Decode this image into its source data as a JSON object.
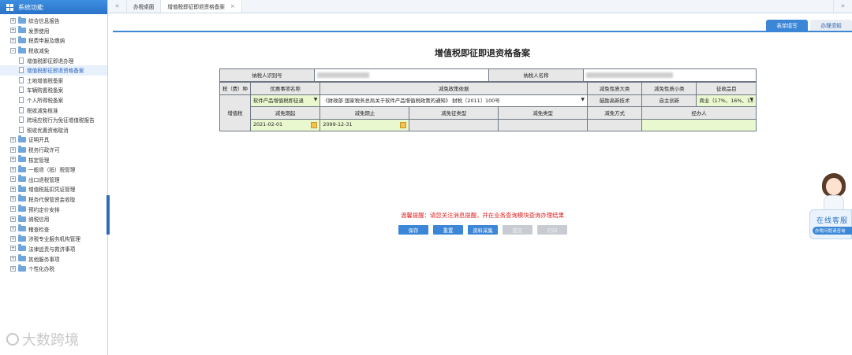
{
  "sidebar": {
    "title": "系统功能",
    "items": [
      {
        "label": "综合信息报告",
        "level": "top",
        "expanded": false
      },
      {
        "label": "发票使用",
        "level": "top",
        "expanded": false
      },
      {
        "label": "税费申报及缴纳",
        "level": "top",
        "expanded": false
      },
      {
        "label": "税收减免",
        "level": "top",
        "expanded": true
      },
      {
        "label": "增值税即征即退办理",
        "level": "child"
      },
      {
        "label": "增值税即征即退资格备案",
        "level": "child",
        "selected": true
      },
      {
        "label": "土地增值税备案",
        "level": "child"
      },
      {
        "label": "车辆购置税备案",
        "level": "child"
      },
      {
        "label": "个人所得税备案",
        "level": "child"
      },
      {
        "label": "税收减免核准",
        "level": "child"
      },
      {
        "label": "跨境应税行为免征增值税报告",
        "level": "child"
      },
      {
        "label": "税收优惠资格取消",
        "level": "child"
      },
      {
        "label": "证明开具",
        "level": "top",
        "expanded": false
      },
      {
        "label": "税务行政许可",
        "level": "top",
        "expanded": false
      },
      {
        "label": "核定管理",
        "level": "top",
        "expanded": false
      },
      {
        "label": "一般退（抵）税管理",
        "level": "top",
        "expanded": false
      },
      {
        "label": "出口退税管理",
        "level": "top",
        "expanded": false
      },
      {
        "label": "增值税抵扣凭证管理",
        "level": "top",
        "expanded": false
      },
      {
        "label": "税务代保管资金收取",
        "level": "top",
        "expanded": false
      },
      {
        "label": "预约定价安排",
        "level": "top",
        "expanded": false
      },
      {
        "label": "纳税信用",
        "level": "top",
        "expanded": false
      },
      {
        "label": "稽查检查",
        "level": "top",
        "expanded": false
      },
      {
        "label": "涉税专业服务机构管理",
        "level": "top",
        "expanded": false
      },
      {
        "label": "法律追责与救济事项",
        "level": "top",
        "expanded": false
      },
      {
        "label": "其他服务事项",
        "level": "top",
        "expanded": false
      },
      {
        "label": "个性化办税",
        "level": "top",
        "expanded": false
      }
    ]
  },
  "topbar": {
    "back_glyph": "«",
    "forward_glyph": "»",
    "tabs": [
      {
        "label": "办税桌面",
        "active": false,
        "closable": false
      },
      {
        "label": "增值税即征即退资格备案",
        "active": true,
        "closable": true
      }
    ],
    "close_glyph": "×"
  },
  "subtabs": {
    "fill": "表单填写",
    "notice": "办理须知"
  },
  "form": {
    "title": "增值税即征即退资格备案",
    "taxpayer_id_label": "纳税人识别号",
    "taxpayer_name_label": "纳税人名称",
    "headers": {
      "tax_type": "税（费）种",
      "preferential_item": "优惠事项名称",
      "policy_basis": "减免政策依据",
      "nature_major": "减免性质大类",
      "nature_minor": "减免性质小类",
      "collection_item": "征收品目"
    },
    "row1": {
      "tax_type": "增值税",
      "preferential_item": "软件产品增值税即征退",
      "policy_basis": "《财政部 国家税务总局关于软件产品增值税政策的通知》 财税〔2011〕100号",
      "nature_major": "鼓励高新技术",
      "nature_minor": "自主创新",
      "collection_item": "商业（17%、16%、13"
    },
    "headers2": {
      "start": "减免期起",
      "end": "减免期止",
      "levy_type": "减免征类型",
      "relief_type": "减免类型",
      "relief_method": "减免方式",
      "handler": "经办人"
    },
    "row2": {
      "start": "2021-02-01",
      "end": "2099-12-31",
      "levy_type": "",
      "relief_type": "",
      "relief_method": "",
      "handler": ""
    }
  },
  "hint": "温馨提醒：请您关注消息提醒，并在业务查询模块查询办理结果",
  "buttons": {
    "save": "保存",
    "reset": "重置",
    "collect": "资料采集",
    "submit": "提交",
    "print": "打印"
  },
  "service": {
    "title": "在线客服",
    "subtitle": "办税问题请咨询"
  },
  "watermark": "大数跨境",
  "colors": {
    "accent": "#3b86d6",
    "hint_red": "#e02020",
    "input_green": "#eaf8cf"
  }
}
